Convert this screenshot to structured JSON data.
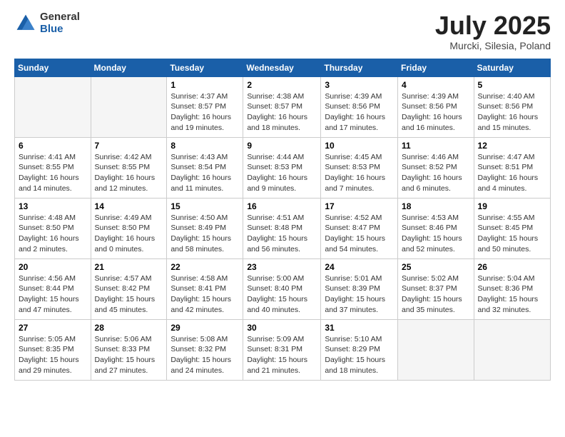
{
  "logo": {
    "general": "General",
    "blue": "Blue"
  },
  "title": {
    "month": "July 2025",
    "location": "Murcki, Silesia, Poland"
  },
  "weekdays": [
    "Sunday",
    "Monday",
    "Tuesday",
    "Wednesday",
    "Thursday",
    "Friday",
    "Saturday"
  ],
  "weeks": [
    [
      {
        "day": "",
        "empty": true
      },
      {
        "day": "",
        "empty": true
      },
      {
        "day": "1",
        "sunrise": "Sunrise: 4:37 AM",
        "sunset": "Sunset: 8:57 PM",
        "daylight": "Daylight: 16 hours and 19 minutes."
      },
      {
        "day": "2",
        "sunrise": "Sunrise: 4:38 AM",
        "sunset": "Sunset: 8:57 PM",
        "daylight": "Daylight: 16 hours and 18 minutes."
      },
      {
        "day": "3",
        "sunrise": "Sunrise: 4:39 AM",
        "sunset": "Sunset: 8:56 PM",
        "daylight": "Daylight: 16 hours and 17 minutes."
      },
      {
        "day": "4",
        "sunrise": "Sunrise: 4:39 AM",
        "sunset": "Sunset: 8:56 PM",
        "daylight": "Daylight: 16 hours and 16 minutes."
      },
      {
        "day": "5",
        "sunrise": "Sunrise: 4:40 AM",
        "sunset": "Sunset: 8:56 PM",
        "daylight": "Daylight: 16 hours and 15 minutes."
      }
    ],
    [
      {
        "day": "6",
        "sunrise": "Sunrise: 4:41 AM",
        "sunset": "Sunset: 8:55 PM",
        "daylight": "Daylight: 16 hours and 14 minutes."
      },
      {
        "day": "7",
        "sunrise": "Sunrise: 4:42 AM",
        "sunset": "Sunset: 8:55 PM",
        "daylight": "Daylight: 16 hours and 12 minutes."
      },
      {
        "day": "8",
        "sunrise": "Sunrise: 4:43 AM",
        "sunset": "Sunset: 8:54 PM",
        "daylight": "Daylight: 16 hours and 11 minutes."
      },
      {
        "day": "9",
        "sunrise": "Sunrise: 4:44 AM",
        "sunset": "Sunset: 8:53 PM",
        "daylight": "Daylight: 16 hours and 9 minutes."
      },
      {
        "day": "10",
        "sunrise": "Sunrise: 4:45 AM",
        "sunset": "Sunset: 8:53 PM",
        "daylight": "Daylight: 16 hours and 7 minutes."
      },
      {
        "day": "11",
        "sunrise": "Sunrise: 4:46 AM",
        "sunset": "Sunset: 8:52 PM",
        "daylight": "Daylight: 16 hours and 6 minutes."
      },
      {
        "day": "12",
        "sunrise": "Sunrise: 4:47 AM",
        "sunset": "Sunset: 8:51 PM",
        "daylight": "Daylight: 16 hours and 4 minutes."
      }
    ],
    [
      {
        "day": "13",
        "sunrise": "Sunrise: 4:48 AM",
        "sunset": "Sunset: 8:50 PM",
        "daylight": "Daylight: 16 hours and 2 minutes."
      },
      {
        "day": "14",
        "sunrise": "Sunrise: 4:49 AM",
        "sunset": "Sunset: 8:50 PM",
        "daylight": "Daylight: 16 hours and 0 minutes."
      },
      {
        "day": "15",
        "sunrise": "Sunrise: 4:50 AM",
        "sunset": "Sunset: 8:49 PM",
        "daylight": "Daylight: 15 hours and 58 minutes."
      },
      {
        "day": "16",
        "sunrise": "Sunrise: 4:51 AM",
        "sunset": "Sunset: 8:48 PM",
        "daylight": "Daylight: 15 hours and 56 minutes."
      },
      {
        "day": "17",
        "sunrise": "Sunrise: 4:52 AM",
        "sunset": "Sunset: 8:47 PM",
        "daylight": "Daylight: 15 hours and 54 minutes."
      },
      {
        "day": "18",
        "sunrise": "Sunrise: 4:53 AM",
        "sunset": "Sunset: 8:46 PM",
        "daylight": "Daylight: 15 hours and 52 minutes."
      },
      {
        "day": "19",
        "sunrise": "Sunrise: 4:55 AM",
        "sunset": "Sunset: 8:45 PM",
        "daylight": "Daylight: 15 hours and 50 minutes."
      }
    ],
    [
      {
        "day": "20",
        "sunrise": "Sunrise: 4:56 AM",
        "sunset": "Sunset: 8:44 PM",
        "daylight": "Daylight: 15 hours and 47 minutes."
      },
      {
        "day": "21",
        "sunrise": "Sunrise: 4:57 AM",
        "sunset": "Sunset: 8:42 PM",
        "daylight": "Daylight: 15 hours and 45 minutes."
      },
      {
        "day": "22",
        "sunrise": "Sunrise: 4:58 AM",
        "sunset": "Sunset: 8:41 PM",
        "daylight": "Daylight: 15 hours and 42 minutes."
      },
      {
        "day": "23",
        "sunrise": "Sunrise: 5:00 AM",
        "sunset": "Sunset: 8:40 PM",
        "daylight": "Daylight: 15 hours and 40 minutes."
      },
      {
        "day": "24",
        "sunrise": "Sunrise: 5:01 AM",
        "sunset": "Sunset: 8:39 PM",
        "daylight": "Daylight: 15 hours and 37 minutes."
      },
      {
        "day": "25",
        "sunrise": "Sunrise: 5:02 AM",
        "sunset": "Sunset: 8:37 PM",
        "daylight": "Daylight: 15 hours and 35 minutes."
      },
      {
        "day": "26",
        "sunrise": "Sunrise: 5:04 AM",
        "sunset": "Sunset: 8:36 PM",
        "daylight": "Daylight: 15 hours and 32 minutes."
      }
    ],
    [
      {
        "day": "27",
        "sunrise": "Sunrise: 5:05 AM",
        "sunset": "Sunset: 8:35 PM",
        "daylight": "Daylight: 15 hours and 29 minutes."
      },
      {
        "day": "28",
        "sunrise": "Sunrise: 5:06 AM",
        "sunset": "Sunset: 8:33 PM",
        "daylight": "Daylight: 15 hours and 27 minutes."
      },
      {
        "day": "29",
        "sunrise": "Sunrise: 5:08 AM",
        "sunset": "Sunset: 8:32 PM",
        "daylight": "Daylight: 15 hours and 24 minutes."
      },
      {
        "day": "30",
        "sunrise": "Sunrise: 5:09 AM",
        "sunset": "Sunset: 8:31 PM",
        "daylight": "Daylight: 15 hours and 21 minutes."
      },
      {
        "day": "31",
        "sunrise": "Sunrise: 5:10 AM",
        "sunset": "Sunset: 8:29 PM",
        "daylight": "Daylight: 15 hours and 18 minutes."
      },
      {
        "day": "",
        "empty": true
      },
      {
        "day": "",
        "empty": true
      }
    ]
  ]
}
